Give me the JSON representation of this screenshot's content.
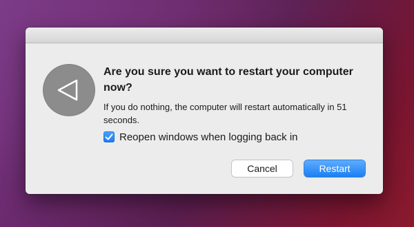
{
  "dialog": {
    "title": "Are you sure you want to restart your computer now?",
    "message": "If you do nothing, the computer will restart automatically in 51 seconds.",
    "icon": "play-back-triangle-icon",
    "checkbox": {
      "label": "Reopen windows when logging back in",
      "checked": true
    },
    "buttons": {
      "cancel_label": "Cancel",
      "restart_label": "Restart"
    }
  },
  "colors": {
    "accent": "#1b80f3",
    "dialog_bg": "#ececec",
    "icon_bg": "#8c8c8c"
  }
}
